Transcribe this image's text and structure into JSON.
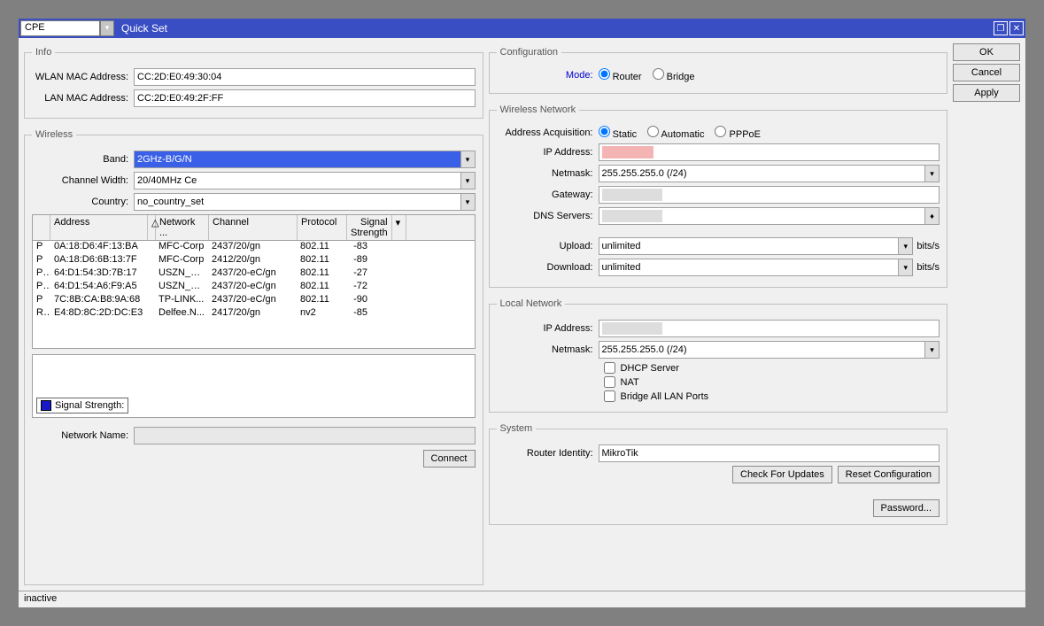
{
  "titlebar": {
    "mode": "CPE",
    "title": "Quick Set"
  },
  "info": {
    "legend": "Info",
    "wlan_label": "WLAN MAC Address:",
    "wlan_mac": "CC:2D:E0:49:30:04",
    "lan_label": "LAN MAC Address:",
    "lan_mac": "CC:2D:E0:49:2F:FF"
  },
  "wireless": {
    "legend": "Wireless",
    "band_label": "Band:",
    "band": "2GHz-B/G/N",
    "chwidth_label": "Channel Width:",
    "chwidth": "20/40MHz Ce",
    "country_label": "Country:",
    "country": "no_country_set",
    "columns": {
      "addr": "Address",
      "net": "Network ...",
      "chan": "Channel",
      "prot": "Protocol",
      "sig": "Signal Strength"
    },
    "networks": [
      {
        "f": "P",
        "addr": "0A:18:D6:4F:13:BA",
        "net": "MFC-Corp",
        "chan": "2437/20/gn",
        "prot": "802.11",
        "sig": "-83",
        "c": "c-orange"
      },
      {
        "f": "P",
        "addr": "0A:18:D6:6B:13:7F",
        "net": "MFC-Corp",
        "chan": "2412/20/gn",
        "prot": "802.11",
        "sig": "-89",
        "c": "c-red"
      },
      {
        "f": "PR",
        "addr": "64:D1:54:3D:7B:17",
        "net": "USZN_M...",
        "chan": "2437/20-eC/gn",
        "prot": "802.11",
        "sig": "-27",
        "c": "c-teal"
      },
      {
        "f": "PR",
        "addr": "64:D1:54:A6:F9:A5",
        "net": "USZN_M...",
        "chan": "2437/20-eC/gn",
        "prot": "802.11",
        "sig": "-72",
        "c": "c-green"
      },
      {
        "f": "P",
        "addr": "7C:8B:CA:B8:9A:68",
        "net": "TP-LINK...",
        "chan": "2437/20-eC/gn",
        "prot": "802.11",
        "sig": "-90",
        "c": "c-red"
      },
      {
        "f": "RB",
        "addr": "E4:8D:8C:2D:DC:E3",
        "net": "Delfee.N...",
        "chan": "2417/20/gn",
        "prot": "nv2",
        "sig": "-85",
        "c": "c-red"
      }
    ],
    "signal_strength_label": "Signal Strength:",
    "network_name_label": "Network Name:",
    "network_name": "",
    "connect": "Connect"
  },
  "config": {
    "legend": "Configuration",
    "mode_label": "Mode:",
    "router": "Router",
    "bridge": "Bridge"
  },
  "wnet": {
    "legend": "Wireless Network",
    "aa_label": "Address Acquisition:",
    "static": "Static",
    "automatic": "Automatic",
    "pppoe": "PPPoE",
    "ip_label": "IP Address:",
    "netmask_label": "Netmask:",
    "netmask": "255.255.255.0 (/24)",
    "gw_label": "Gateway:",
    "dns_label": "DNS Servers:",
    "upload_label": "Upload:",
    "upload": "unlimited",
    "unit_up": "bits/s",
    "download_label": "Download:",
    "download": "unlimited",
    "unit_down": "bits/s"
  },
  "lnet": {
    "legend": "Local Network",
    "ip_label": "IP Address:",
    "netmask_label": "Netmask:",
    "netmask": "255.255.255.0 (/24)",
    "dhcp": "DHCP Server",
    "nat": "NAT",
    "bridge": "Bridge All LAN Ports"
  },
  "system": {
    "legend": "System",
    "ri_label": "Router Identity:",
    "ri": "MikroTik",
    "check": "Check For Updates",
    "reset": "Reset Configuration",
    "password": "Password..."
  },
  "buttons": {
    "ok": "OK",
    "cancel": "Cancel",
    "apply": "Apply"
  },
  "status": "inactive"
}
